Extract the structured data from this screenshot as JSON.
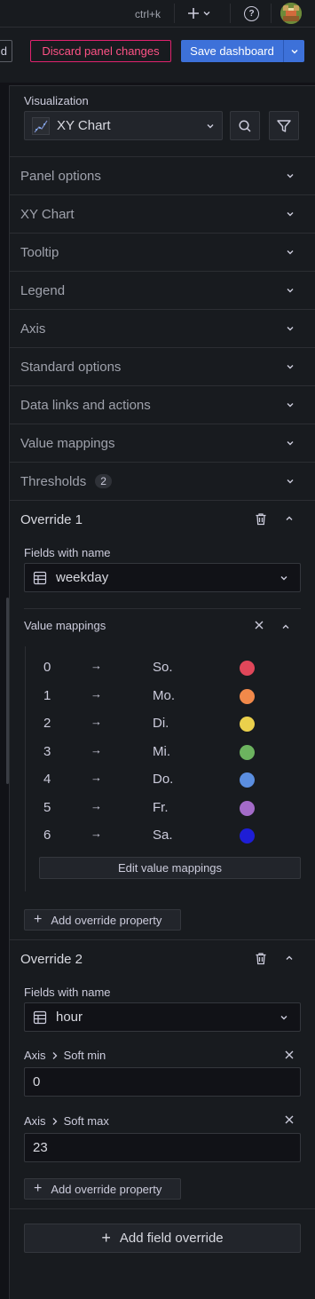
{
  "topbar": {
    "shortcut": "ctrl+k",
    "help_glyph": "?"
  },
  "actions": {
    "cut_button_tail": "d",
    "discard_label": "Discard panel changes",
    "save_label": "Save dashboard"
  },
  "visualization": {
    "label": "Visualization",
    "selected": "XY Chart"
  },
  "sections": [
    {
      "label": "Panel options"
    },
    {
      "label": "XY Chart"
    },
    {
      "label": "Tooltip"
    },
    {
      "label": "Legend"
    },
    {
      "label": "Axis"
    },
    {
      "label": "Standard options"
    },
    {
      "label": "Data links and actions"
    },
    {
      "label": "Value mappings"
    },
    {
      "label": "Thresholds",
      "badge": "2"
    }
  ],
  "override1": {
    "title": "Override 1",
    "matcher_label": "Fields with name",
    "matcher_value": "weekday",
    "property_title": "Value mappings",
    "mappings": [
      {
        "from": "0",
        "to": "So.",
        "color": "#e0475a"
      },
      {
        "from": "1",
        "to": "Mo.",
        "color": "#f1894a"
      },
      {
        "from": "2",
        "to": "Di.",
        "color": "#ead04c"
      },
      {
        "from": "3",
        "to": "Mi.",
        "color": "#6cb35f"
      },
      {
        "from": "4",
        "to": "Do.",
        "color": "#5b8ee0"
      },
      {
        "from": "5",
        "to": "Fr.",
        "color": "#a36bc8"
      },
      {
        "from": "6",
        "to": "Sa.",
        "color": "#1e1ed6"
      }
    ],
    "edit_label": "Edit value mappings",
    "add_property_label": "Add override property"
  },
  "override2": {
    "title": "Override 2",
    "matcher_label": "Fields with name",
    "matcher_value": "hour",
    "prop1_group": "Axis",
    "prop1_name": "Soft min",
    "prop1_value": "0",
    "prop2_group": "Axis",
    "prop2_name": "Soft max",
    "prop2_value": "23",
    "add_property_label": "Add override property"
  },
  "add_field_override_label": "Add field override"
}
